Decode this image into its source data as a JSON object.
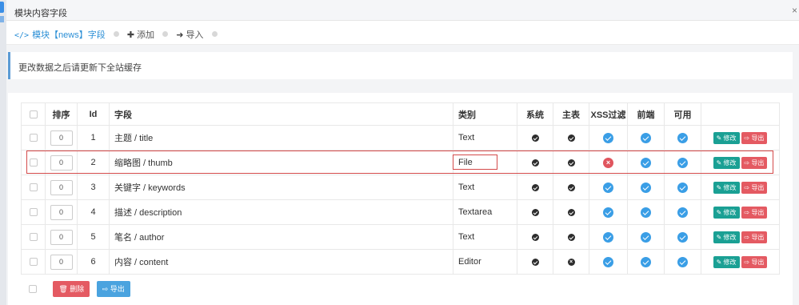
{
  "window": {
    "title": "模块内容字段",
    "close_glyph": "×"
  },
  "breadcrumb": {
    "code_icon": "</>",
    "module_link": "模块【news】字段",
    "add_icon": "✚",
    "add_label": "添加",
    "import_icon": "➜",
    "import_label": "导入"
  },
  "notice": "更改数据之后请更新下全站缓存",
  "table": {
    "headers": {
      "sort": "排序",
      "id": "Id",
      "field": "字段",
      "type": "类别",
      "system": "系统",
      "main": "主表",
      "xss": "XSS过滤",
      "frontend": "前端",
      "enabled": "可用"
    },
    "rows": [
      {
        "order": "0",
        "id": "1",
        "field": "主题 / title",
        "type": "Text",
        "system": "check",
        "main": "check",
        "xss": "check",
        "frontend": "check",
        "enabled": "check"
      },
      {
        "order": "0",
        "id": "2",
        "field": "缩略图 / thumb",
        "type": "File",
        "system": "check",
        "main": "check",
        "xss": "cross",
        "frontend": "check",
        "enabled": "check"
      },
      {
        "order": "0",
        "id": "3",
        "field": "关键字 / keywords",
        "type": "Text",
        "system": "check",
        "main": "check",
        "xss": "check",
        "frontend": "check",
        "enabled": "check"
      },
      {
        "order": "0",
        "id": "4",
        "field": "描述 / description",
        "type": "Textarea",
        "system": "check",
        "main": "check",
        "xss": "check",
        "frontend": "check",
        "enabled": "check"
      },
      {
        "order": "0",
        "id": "5",
        "field": "笔名 / author",
        "type": "Text",
        "system": "check",
        "main": "check",
        "xss": "check",
        "frontend": "check",
        "enabled": "check"
      },
      {
        "order": "0",
        "id": "6",
        "field": "内容 / content",
        "type": "Editor",
        "system": "check",
        "main": "cross",
        "xss": "check",
        "frontend": "check",
        "enabled": "check"
      }
    ],
    "edit_label": "修改",
    "export_label": "导出"
  },
  "footer": {
    "delete_label": "删除",
    "export_label": "导出"
  },
  "colors": {
    "accent": "#3a9ee6",
    "edit": "#1aa094",
    "danger": "#e45a62",
    "highlight": "#d44a4a"
  }
}
